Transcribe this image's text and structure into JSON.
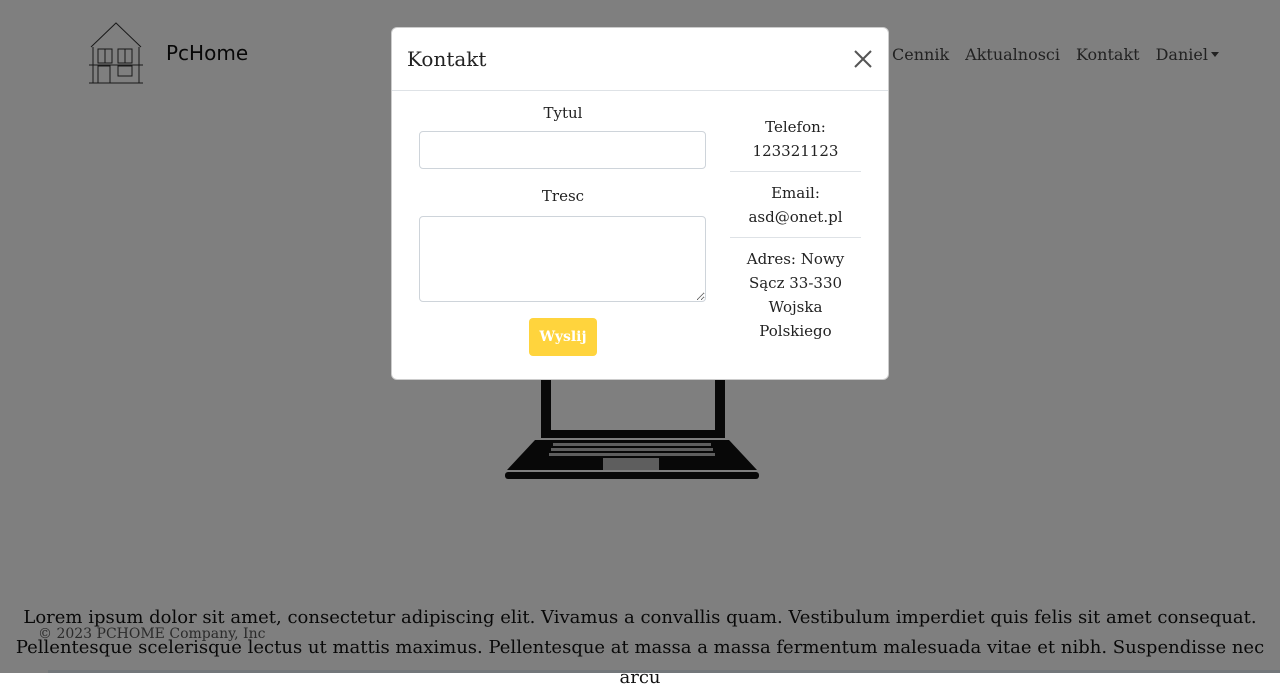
{
  "brand": {
    "name": "PcHome"
  },
  "nav": {
    "items": [
      "Cennik",
      "Aktualnosci",
      "Kontakt"
    ],
    "user": "Daniel"
  },
  "content": {
    "paragraph_lines": [
      "Lorem ipsum dolor sit amet, consectetur adipiscing elit. Vivamus a convallis quam. Vestibulum imperdiet quis felis sit amet consequat.",
      "Pellentesque scelerisque lectus ut mattis maximus. Pellentesque at massa a massa fermentum malesuada vitae et nibh. Suspendisse nec arcu"
    ]
  },
  "footer": {
    "copyright": "© 2023 PCHOME Company, Inc"
  },
  "modal": {
    "title": "Kontakt",
    "form": {
      "title_label": "Tytul",
      "title_value": "",
      "content_label": "Tresc",
      "content_value": "",
      "submit_label": "Wyslij",
      "submit_color": "#ffd43d"
    },
    "info": {
      "phone_label": "Telefon:",
      "phone": "123321123",
      "email_label": "Email:",
      "email": "asd@onet.pl",
      "address_lines": [
        "Adres: Nowy",
        "Sącz 33-330",
        "Wojska",
        "Polskiego"
      ]
    }
  },
  "icons": {
    "close": "close-icon",
    "logo": "house-logo-icon",
    "hero": "laptop-icon",
    "dropdown": "caret-down-icon"
  }
}
